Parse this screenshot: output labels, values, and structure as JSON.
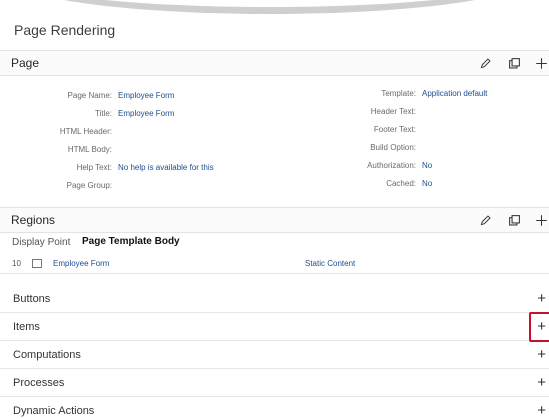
{
  "title": "Page Rendering",
  "page_section": {
    "label": "Page",
    "left_fields": [
      {
        "label": "Page Name:",
        "value": "Employee Form"
      },
      {
        "label": "Title:",
        "value": "Employee Form"
      },
      {
        "label": "HTML Header:",
        "value": ""
      },
      {
        "label": "HTML Body:",
        "value": ""
      },
      {
        "label": "Help Text:",
        "value": "No help is available for this"
      },
      {
        "label": "Page Group:",
        "value": ""
      }
    ],
    "right_fields": [
      {
        "label": "Template:",
        "value": "Application default"
      },
      {
        "label": "Header Text:",
        "value": ""
      },
      {
        "label": "Footer Text:",
        "value": ""
      },
      {
        "label": "Build Option:",
        "value": ""
      },
      {
        "label": "Authorization:",
        "value": "No"
      },
      {
        "label": "Cached:",
        "value": "No"
      }
    ]
  },
  "regions_section": {
    "label": "Regions",
    "display_point_label": "Display Point",
    "display_point_value": "Page Template Body",
    "rows": [
      {
        "seq": "10",
        "name": "Employee Form",
        "type": "Static Content"
      }
    ]
  },
  "list_sections": [
    {
      "label": "Buttons"
    },
    {
      "label": "Items"
    },
    {
      "label": "Computations"
    },
    {
      "label": "Processes"
    },
    {
      "label": "Dynamic Actions"
    }
  ],
  "icons": {
    "edit": "pencil-icon",
    "copy": "copy-icon",
    "add": "plus-icon"
  },
  "colors": {
    "link": "#1f4d8f",
    "highlight_border": "#c8102e"
  }
}
